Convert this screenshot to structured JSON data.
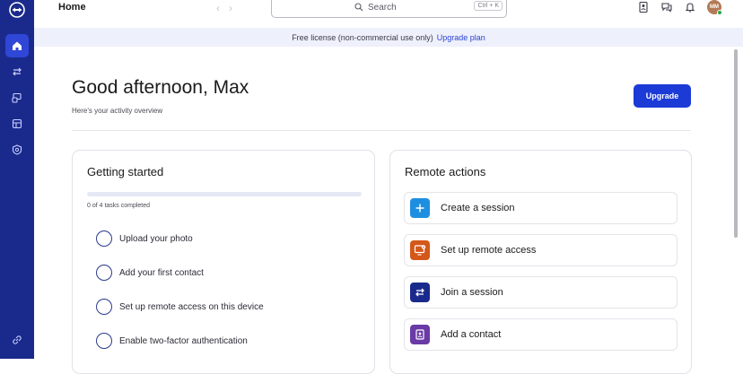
{
  "topbar": {
    "title": "Home",
    "search_label": "Search",
    "search_shortcut": "Ctrl + K",
    "avatar_initials": "MM"
  },
  "banner": {
    "text": "Free license (non-commercial use only)",
    "link": "Upgrade plan"
  },
  "header": {
    "greeting": "Good afternoon, Max",
    "subtitle": "Here's your activity overview",
    "upgrade_label": "Upgrade"
  },
  "getting_started": {
    "title": "Getting started",
    "progress_fraction": 0,
    "progress_text": "0 of 4 tasks completed",
    "tasks": [
      {
        "label": "Upload your photo"
      },
      {
        "label": "Add your first contact"
      },
      {
        "label": "Set up remote access on this device"
      },
      {
        "label": "Enable two-factor authentication"
      }
    ]
  },
  "remote_actions": {
    "title": "Remote actions",
    "items": [
      {
        "label": "Create a session",
        "icon": "plus-icon",
        "color": "#1e8fe0"
      },
      {
        "label": "Set up remote access",
        "icon": "monitor-settings-icon",
        "color": "#d4581a"
      },
      {
        "label": "Join a session",
        "icon": "swap-arrows-icon",
        "color": "#1a2a8c"
      },
      {
        "label": "Add a contact",
        "icon": "contact-book-icon",
        "color": "#6a3aa6"
      }
    ]
  },
  "colors": {
    "rail": "#1a2a8c",
    "accent": "#1c3ad6",
    "banner_bg": "#eef0fb"
  }
}
